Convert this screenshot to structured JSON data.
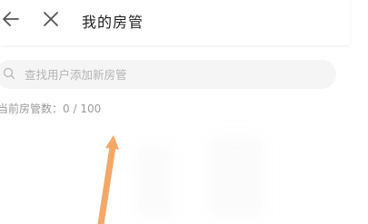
{
  "header": {
    "title": "我的房管",
    "back_icon": "arrow-left-icon",
    "close_icon": "close-icon"
  },
  "search": {
    "placeholder": "查找用户添加新房管",
    "value": "",
    "icon": "search-icon"
  },
  "status": {
    "label": "当前房管数：",
    "count_text": "0 / 100"
  },
  "annotation": {
    "arrow_color": "#f4a868"
  }
}
